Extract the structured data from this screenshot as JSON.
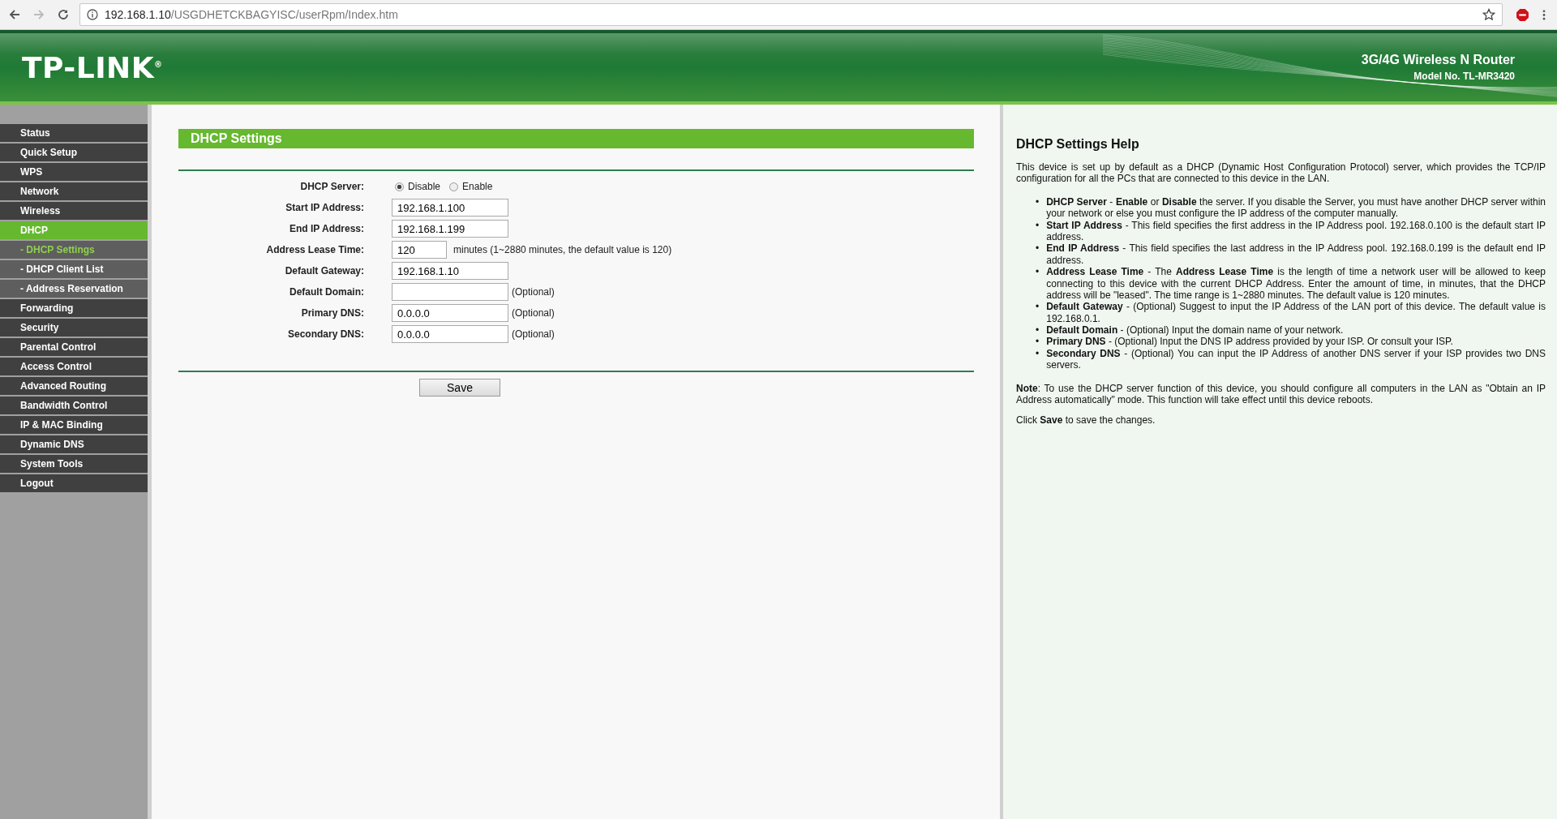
{
  "browser": {
    "url_host": "192.168.1.10",
    "url_path": "/USGDHETCKBAGYISC/userRpm/Index.htm",
    "forward_disabled": true
  },
  "header": {
    "brand": "TP-LINK$^{®}$",
    "product": "3G/4G Wireless N Router",
    "model": "Model No. TL-MR3420"
  },
  "sidebar": {
    "items": [
      {
        "label": "Status",
        "kind": "main",
        "selected": false
      },
      {
        "label": "Quick Setup",
        "kind": "main",
        "selected": false
      },
      {
        "label": "WPS",
        "kind": "main",
        "selected": false
      },
      {
        "label": "Network",
        "kind": "main",
        "selected": false
      },
      {
        "label": "Wireless",
        "kind": "main",
        "selected": false
      },
      {
        "label": "DHCP",
        "kind": "main",
        "selected": true
      },
      {
        "label": "- DHCP Settings",
        "kind": "sub",
        "selected": true
      },
      {
        "label": "- DHCP Client List",
        "kind": "sub",
        "selected": false
      },
      {
        "label": "- Address Reservation",
        "kind": "sub",
        "selected": false
      },
      {
        "label": "Forwarding",
        "kind": "main",
        "selected": false
      },
      {
        "label": "Security",
        "kind": "main",
        "selected": false
      },
      {
        "label": "Parental Control",
        "kind": "main",
        "selected": false
      },
      {
        "label": "Access Control",
        "kind": "main",
        "selected": false
      },
      {
        "label": "Advanced Routing",
        "kind": "main",
        "selected": false
      },
      {
        "label": "Bandwidth Control",
        "kind": "main",
        "selected": false
      },
      {
        "label": "IP & MAC Binding",
        "kind": "main",
        "selected": false
      },
      {
        "label": "Dynamic DNS",
        "kind": "main",
        "selected": false
      },
      {
        "label": "System Tools",
        "kind": "main",
        "selected": false
      },
      {
        "label": "Logout",
        "kind": "main",
        "selected": false
      }
    ]
  },
  "form": {
    "title": "DHCP Settings",
    "rows": [
      {
        "label": "DHCP Server:",
        "kind": "radio",
        "options": [
          {
            "label": "Disable",
            "selected": true
          },
          {
            "label": "Enable",
            "selected": false
          }
        ]
      },
      {
        "label": "Start IP Address:",
        "kind": "text",
        "value": "192.168.1.100"
      },
      {
        "label": "End IP Address:",
        "kind": "text",
        "value": "192.168.1.199"
      },
      {
        "label": "Address Lease Time:",
        "kind": "short-text",
        "value": "120",
        "note": "minutes (1~2880 minutes, the default value is 120)"
      },
      {
        "label": "Default Gateway:",
        "kind": "text",
        "value": "192.168.1.10"
      },
      {
        "label": "Default Domain:",
        "kind": "text",
        "note": "(Optional)"
      },
      {
        "label": "Primary DNS:",
        "kind": "text",
        "value": "0.0.0.0",
        "note": "(Optional)"
      },
      {
        "label": "Secondary DNS:",
        "kind": "text",
        "value": "0.0.0.0",
        "note": "(Optional)"
      }
    ],
    "save_button": "Save"
  },
  "help": {
    "title": "DHCP Settings Help",
    "intro": "This device is set up by default as a DHCP (Dynamic Host Configuration Protocol) server, which provides the TCP/IP configuration for all the PCs that are connected to this device in the LAN.",
    "marker": "•",
    "items": [
      "**DHCP Server** - **Enable** or **Disable** the server. If you disable the Server, you must have another DHCP server within your network or else you must configure the IP address of the computer manually.",
      "**Start IP Address** - This field specifies the first address in the IP Address pool. 192.168.0.100 is the default start IP address.",
      "**End IP Address** - This field specifies the last address in the IP Address pool. 192.168.0.199 is the default end IP address.",
      "**Address Lease Time** - The **Address Lease Time** is the length of time a network user will be allowed to keep connecting to this device with the current DHCP Address. Enter the amount of time, in minutes, that the DHCP address will be \"leased\". The time range is 1~2880 minutes. The default value is 120 minutes.",
      "**Default Gateway** - (Optional) Suggest to input the IP Address of the LAN port of this device. The default value is 192.168.0.1.",
      "**Default Domain** - (Optional) Input the domain name of your network.",
      "**Primary DNS** - (Optional) Input the DNS IP address provided by your ISP. Or consult your ISP.",
      "**Secondary DNS** - (Optional) You can input the IP Address of another DNS server if your ISP provides two DNS servers."
    ],
    "note": "**Note**: To use the DHCP server function of this device, you should configure all computers in the LAN as \"Obtain an IP Address automatically\" mode. This function will take effect until this device reboots.",
    "footer": "Click **Save** to save the changes."
  }
}
